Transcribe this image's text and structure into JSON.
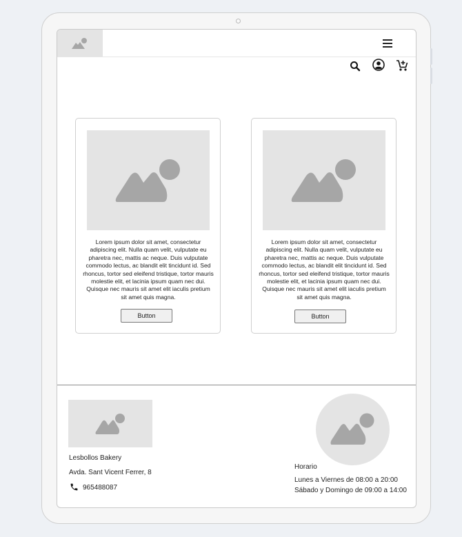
{
  "header": {
    "logo_icon": "image-placeholder-icon",
    "menu_icon": "hamburger-menu-icon",
    "search_icon": "search-icon",
    "account_icon": "account-circle-icon",
    "cart_icon": "add-to-cart-icon"
  },
  "cards": [
    {
      "text": "Lorem ipsum dolor sit amet, consectetur adipiscing elit. Nulla quam velit, vulputate eu pharetra nec, mattis ac neque. Duis vulputate commodo lectus, ac blandit elit tincidunt id. Sed rhoncus, tortor sed eleifend tristique, tortor mauris molestie elit, et lacinia ipsum quam nec dui. Quisque nec mauris sit amet elit iaculis pretium sit amet quis magna.",
      "button_label": "Button"
    },
    {
      "text": "Lorem ipsum dolor sit amet, consectetur adipiscing elit. Nulla quam velit, vulputate eu pharetra nec, mattis ac neque. Duis vulputate commodo lectus, ac blandit elit tincidunt id. Sed rhoncus, tortor sed eleifend tristique, tortor mauris molestie elit, et lacinia ipsum quam nec dui. Quisque nec mauris sit amet elit iaculis pretium sit amet quis magna.",
      "button_label": "Button"
    }
  ],
  "footer": {
    "business_name": "Lesbollos Bakery",
    "address": "Avda. Sant Vicent Ferrer, 8",
    "phone": "965488087",
    "phone_icon": "phone-icon",
    "schedule_title": "Horario",
    "weekday_hours": "Lunes a Viernes de 08:00 a 20:00",
    "weekend_hours": "Sábado y Domingo de 09:00 a 14:00"
  },
  "colors": {
    "placeholder_bg": "#e4e4e4",
    "placeholder_fg": "#a6a6a6",
    "border": "#cfcfcf"
  }
}
